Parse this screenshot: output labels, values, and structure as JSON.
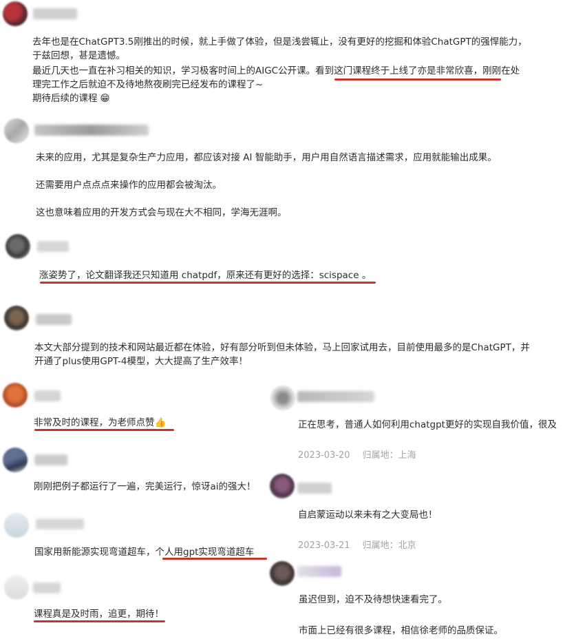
{
  "comments": [
    {
      "lines": [
        "去年也是在ChatGPT3.5刚推出的时候，就上手做了体验，但是浅尝辄止，没有更好的挖掘和体验ChatGPT的强悍能力，",
        "于兹回想，甚是遗憾。",
        "最近几天也一直在补习相关的知识，学习极客时间上的AIGC公开课。看到这门课程终于上线了亦是非常欣喜，刚刚在处",
        "理完工作之后就迫不及待地熬夜刷完已经发布的课程了~",
        "期待后续的课程"
      ],
      "emoji": "😁"
    },
    {
      "lines": [
        "未来的应用，尤其是复杂生产力应用，都应该对接 AI 智能助手，用户用自然语言描述需求，应用就能输出成果。",
        "还需要用户点点点来操作的应用都会被淘汰。",
        "这也意味着应用的开发方式会与现在大不相同，学海无涯啊。"
      ]
    },
    {
      "lines": [
        "涨姿势了，论文翻译我还只知道用 chatpdf，原来还有更好的选择：scispace 。"
      ]
    },
    {
      "lines": [
        "本文大部分提到的技术和网站最近都在体验，好有部分听到但未体验，马上回家试用去，目前使用最多的是ChatGPT，并",
        "开通了plus使用GPT-4模型，大大提高了生产效率！"
      ]
    },
    {
      "lines": [
        "非常及时的课程，为老师点赞"
      ],
      "emoji": "👍"
    },
    {
      "lines": [
        "刚刚把例子都运行了一遍，完美运行，惊讶ai的强大！"
      ]
    },
    {
      "lines": [
        "国家用新能源实现弯道超车，个人用gpt实现弯道超车"
      ]
    },
    {
      "lines": [
        "课程真是及时雨，追更，期待！"
      ]
    },
    {
      "lines": [
        "正在思考，普通人如何利用chatgpt更好的实现自我价值，很及"
      ],
      "date": "2023-03-20",
      "location_label": "归属地：",
      "location": "上海"
    },
    {
      "lines": [
        "自启蒙运动以来未有之大变局也！"
      ],
      "date": "2023-03-21",
      "location_label": "归属地：",
      "location": "北京"
    },
    {
      "lines": [
        "虽迟但到，迫不及待想快速看完了。",
        "市面上已经有很多课程，相信徐老师的品质保证。"
      ]
    }
  ],
  "colors": {
    "underline": "#c9332c",
    "text": "#2c2c2c",
    "meta": "#a3a3a3"
  }
}
